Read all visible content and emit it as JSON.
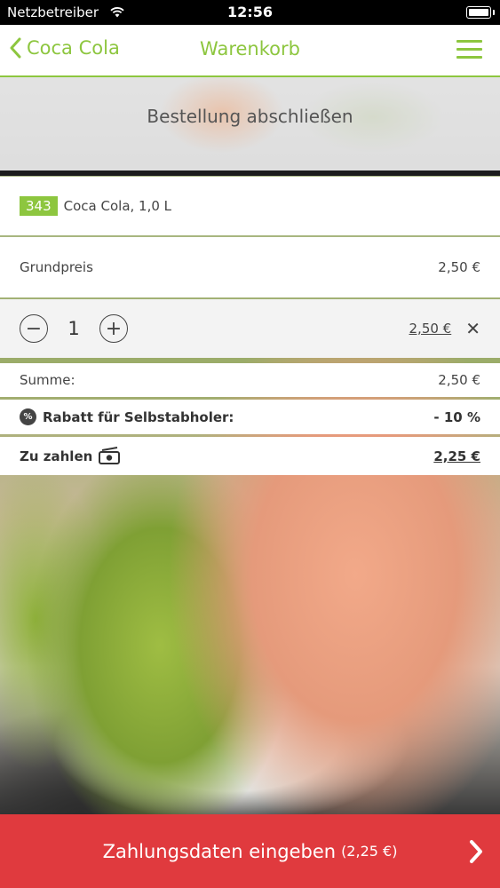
{
  "status_bar": {
    "carrier": "Netzbetreiber",
    "time": "12:56"
  },
  "nav": {
    "back_label": "Coca Cola",
    "title": "Warenkorb"
  },
  "header": {
    "title": "Bestellung abschließen"
  },
  "cart_item": {
    "number": "343",
    "name": "Coca Cola, 1,0 L"
  },
  "base_price": {
    "label": "Grundpreis",
    "value": "2,50 €"
  },
  "quantity": {
    "minus": "−",
    "value": "1",
    "plus": "+",
    "line_total": "2,50 €",
    "remove": "✕"
  },
  "summary": {
    "sum_label": "Summe:",
    "sum_value": "2,50 €",
    "discount_label": "Rabatt für Selbstabholer:",
    "discount_value": "- 10 %",
    "discount_icon_text": "%",
    "pay_label": "Zu zahlen",
    "pay_value": "2,25 €"
  },
  "footer": {
    "button_label": "Zahlungsdaten eingeben",
    "button_amount": "(2,25 €)"
  },
  "colors": {
    "accent": "#8dc63f",
    "cta": "#e03a3e"
  }
}
